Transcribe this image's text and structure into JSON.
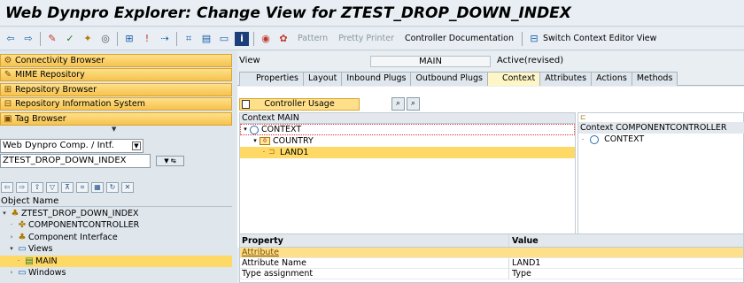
{
  "window": {
    "title": "Web Dynpro Explorer: Change View for ZTEST_DROP_DOWN_INDEX"
  },
  "toolbar": {
    "pattern": "Pattern",
    "pretty_printer": "Pretty Printer",
    "controller_documentation": "Controller Documentation",
    "switch_context": "Switch Context Editor View"
  },
  "nav": {
    "items": [
      "Connectivity Browser",
      "MIME Repository",
      "Repository Browser",
      "Repository Information System",
      "Tag Browser"
    ]
  },
  "left": {
    "combo": "Web Dynpro Comp. / Intf.",
    "input": "ZTEST_DROP_DOWN_INDEX",
    "object_header": "Object Name",
    "tree": [
      {
        "label": "ZTEST_DROP_DOWN_INDEX"
      },
      {
        "label": "COMPONENTCONTROLLER"
      },
      {
        "label": "Component Interface"
      },
      {
        "label": "Views"
      },
      {
        "label": "MAIN"
      },
      {
        "label": "Windows"
      }
    ]
  },
  "view": {
    "label": "View",
    "name": "MAIN",
    "status": "Active(revised)"
  },
  "tabs": [
    "Properties",
    "Layout",
    "Inbound Plugs",
    "Outbound Plugs",
    "Context",
    "Attributes",
    "Actions",
    "Methods"
  ],
  "controller_usage": "Controller Usage",
  "context": {
    "header": "Context MAIN",
    "nodes": [
      "CONTEXT",
      "COUNTRY",
      "LAND1"
    ]
  },
  "cc": {
    "header": "Context COMPONENTCONTROLLER",
    "node": "CONTEXT"
  },
  "properties": {
    "col_property": "Property",
    "col_value": "Value",
    "group": "Attribute",
    "rows": [
      {
        "property": "Attribute Name",
        "value": "LAND1"
      },
      {
        "property": "Type assignment",
        "value": "Type"
      }
    ]
  }
}
